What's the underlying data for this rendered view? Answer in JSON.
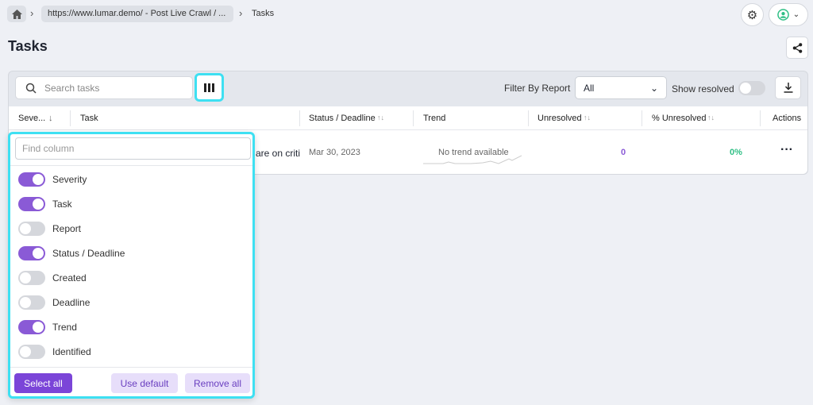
{
  "breadcrumb": {
    "link": "https://www.lumar.demo/ - Post Live Crawl / ...",
    "current": "Tasks"
  },
  "page_title": "Tasks",
  "toolbar": {
    "search_placeholder": "Search tasks",
    "filter_label": "Filter By Report",
    "filter_value": "All",
    "show_resolved": "Show resolved",
    "show_resolved_on": false
  },
  "table": {
    "columns": [
      "Seve...",
      "Task",
      "Status / Deadline",
      "Trend",
      "Unresolved",
      "% Unresolved",
      "Actions"
    ],
    "rows": [
      {
        "task": "are on criti",
        "deadline": "Mar 30, 2023",
        "trend": "No trend available",
        "unresolved": "0",
        "pct_unresolved": "0%"
      }
    ]
  },
  "column_picker": {
    "find_placeholder": "Find column",
    "columns": [
      {
        "label": "Severity",
        "on": true
      },
      {
        "label": "Task",
        "on": true
      },
      {
        "label": "Report",
        "on": false
      },
      {
        "label": "Status / Deadline",
        "on": true
      },
      {
        "label": "Created",
        "on": false
      },
      {
        "label": "Deadline",
        "on": false
      },
      {
        "label": "Trend",
        "on": true
      },
      {
        "label": "Identified",
        "on": false
      }
    ],
    "select_all": "Select all",
    "use_default": "Use default",
    "remove_all": "Remove all"
  },
  "colors": {
    "accent": "#8a5ad6",
    "highlight": "#3ee0f2",
    "unresolved": "#8a5ad6",
    "pct": "#2fbf85"
  }
}
